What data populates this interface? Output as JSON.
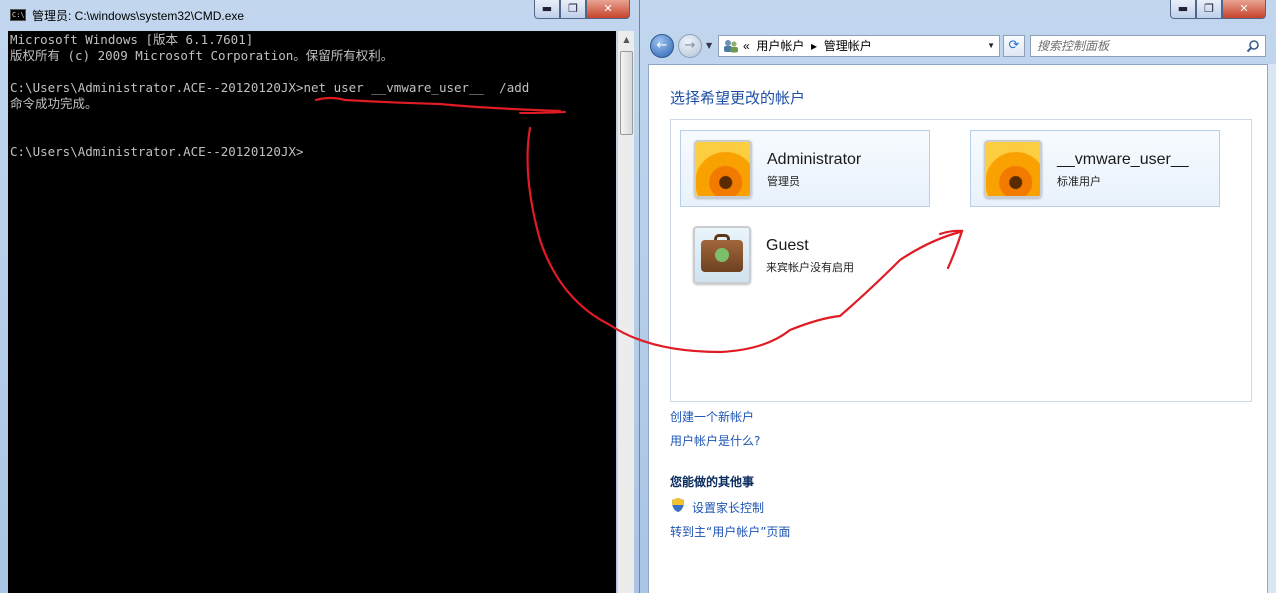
{
  "cmd_window": {
    "title": "管理员: C:\\windows\\system32\\CMD.exe",
    "icon_label": "C:\\.",
    "buttons": {
      "minimize": "▬",
      "maximize": "❐",
      "close": "✕"
    },
    "lines": [
      "Microsoft Windows [版本 6.1.7601]",
      "版权所有 (c) 2009 Microsoft Corporation。保留所有权利。",
      "",
      "C:\\Users\\Administrator.ACE--20120120JX>net user __vmware_user__  /add",
      "命令成功完成。",
      "",
      "",
      "C:\\Users\\Administrator.ACE--20120120JX>"
    ]
  },
  "cp_window": {
    "buttons": {
      "minimize": "▬",
      "maximize": "❐",
      "close": "✕"
    },
    "breadcrumb": "«  用户帐户  ▸  管理帐户",
    "search_placeholder": "搜索控制面板",
    "heading": "选择希望更改的帐户",
    "accounts": [
      {
        "name": "Administrator",
        "role": "管理员"
      },
      {
        "name": "__vmware_user__",
        "role": "标准用户"
      },
      {
        "name": "Guest",
        "role": "来宾帐户没有启用"
      }
    ],
    "links": {
      "create_account": "创建一个新帐户",
      "what_is_account": "用户帐户是什么?",
      "other_things_heading": "您能做的其他事",
      "parental_controls": "设置家长控制",
      "go_main_page": "转到主“用户帐户”页面"
    }
  },
  "colors": {
    "annotation_red": "#e01b24",
    "link_blue": "#1e55b4",
    "heading_blue": "#1e4fa4"
  }
}
